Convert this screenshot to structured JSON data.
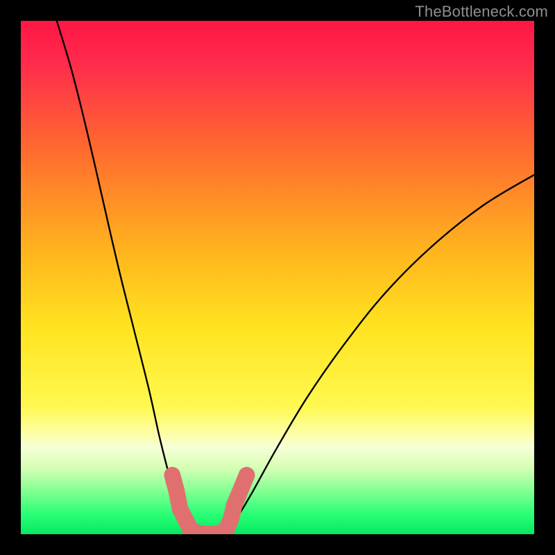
{
  "watermark": "TheBottleneck.com",
  "chart_data": {
    "type": "line",
    "title": "",
    "xlabel": "",
    "ylabel": "",
    "xlim": [
      0,
      100
    ],
    "ylim": [
      0,
      100
    ],
    "grid": false,
    "legend": false,
    "background_gradient_stops": [
      {
        "y_pct": 0,
        "color": "#ff1744"
      },
      {
        "y_pct": 8,
        "color": "#ff2a4d"
      },
      {
        "y_pct": 25,
        "color": "#ff6a2f"
      },
      {
        "y_pct": 45,
        "color": "#ffb51e"
      },
      {
        "y_pct": 60,
        "color": "#ffe421"
      },
      {
        "y_pct": 75,
        "color": "#fff84f"
      },
      {
        "y_pct": 81,
        "color": "#fcffb0"
      },
      {
        "y_pct": 83,
        "color": "#f6ffd8"
      },
      {
        "y_pct": 87,
        "color": "#d7ffb5"
      },
      {
        "y_pct": 92,
        "color": "#7bff8f"
      },
      {
        "y_pct": 96,
        "color": "#2bff77"
      },
      {
        "y_pct": 100,
        "color": "#06e861"
      }
    ],
    "series": [
      {
        "name": "left-curve",
        "stroke": "#000000",
        "points": [
          {
            "x": 7,
            "y": 100
          },
          {
            "x": 10,
            "y": 90
          },
          {
            "x": 13,
            "y": 78
          },
          {
            "x": 16,
            "y": 65
          },
          {
            "x": 19,
            "y": 52
          },
          {
            "x": 22,
            "y": 40
          },
          {
            "x": 25,
            "y": 28
          },
          {
            "x": 27,
            "y": 19
          },
          {
            "x": 29,
            "y": 11
          },
          {
            "x": 30.5,
            "y": 5
          },
          {
            "x": 32,
            "y": 2
          },
          {
            "x": 34,
            "y": 0
          }
        ]
      },
      {
        "name": "right-curve",
        "stroke": "#000000",
        "points": [
          {
            "x": 40,
            "y": 0
          },
          {
            "x": 42,
            "y": 3
          },
          {
            "x": 45,
            "y": 8
          },
          {
            "x": 50,
            "y": 17
          },
          {
            "x": 56,
            "y": 27
          },
          {
            "x": 63,
            "y": 37
          },
          {
            "x": 71,
            "y": 47
          },
          {
            "x": 80,
            "y": 56
          },
          {
            "x": 90,
            "y": 64
          },
          {
            "x": 100,
            "y": 70
          }
        ]
      }
    ],
    "marker_series": {
      "name": "bottom-markers",
      "color": "#e07070",
      "radius_pct": 1.6,
      "points": [
        {
          "x": 29.5,
          "y": 11.5
        },
        {
          "x": 30.3,
          "y": 8.5
        },
        {
          "x": 31.0,
          "y": 5.0
        },
        {
          "x": 33.0,
          "y": 1.0
        },
        {
          "x": 34.5,
          "y": 0.2
        },
        {
          "x": 36.0,
          "y": 0.0
        },
        {
          "x": 37.5,
          "y": 0.0
        },
        {
          "x": 39.0,
          "y": 0.3
        },
        {
          "x": 40.2,
          "y": 1.2
        },
        {
          "x": 41.0,
          "y": 3.2
        },
        {
          "x": 41.6,
          "y": 5.7
        },
        {
          "x": 44.0,
          "y": 11.5
        }
      ]
    }
  }
}
